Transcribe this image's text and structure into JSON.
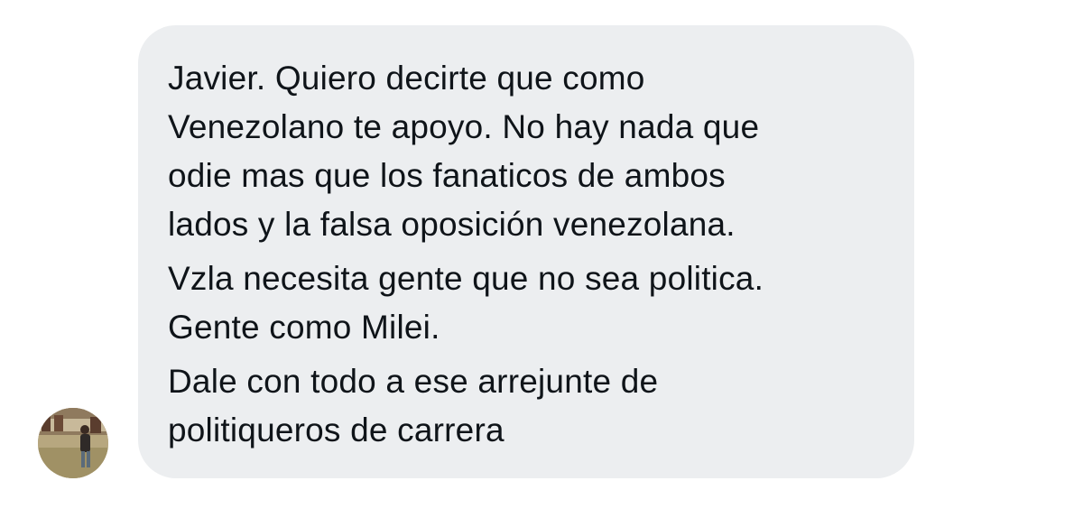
{
  "message": {
    "paragraphs": [
      {
        "lines": [
          "Javier. Quiero decirte que como",
          "Venezolano te apoyo. No hay nada que",
          "odie mas que los fanaticos de ambos",
          "lados y la falsa oposición venezolana."
        ]
      },
      {
        "lines": [
          "Vzla necesita gente que no sea politica.",
          "Gente como Milei."
        ]
      },
      {
        "lines": [
          "Dale con todo a ese arrejunte de",
          "politiqueros de carrera"
        ]
      }
    ]
  },
  "colors": {
    "page_background": "#ffffff",
    "bubble_background": "#eceef0",
    "text": "#0f1419"
  },
  "icons": {
    "sender_avatar": "user-avatar-photo"
  }
}
